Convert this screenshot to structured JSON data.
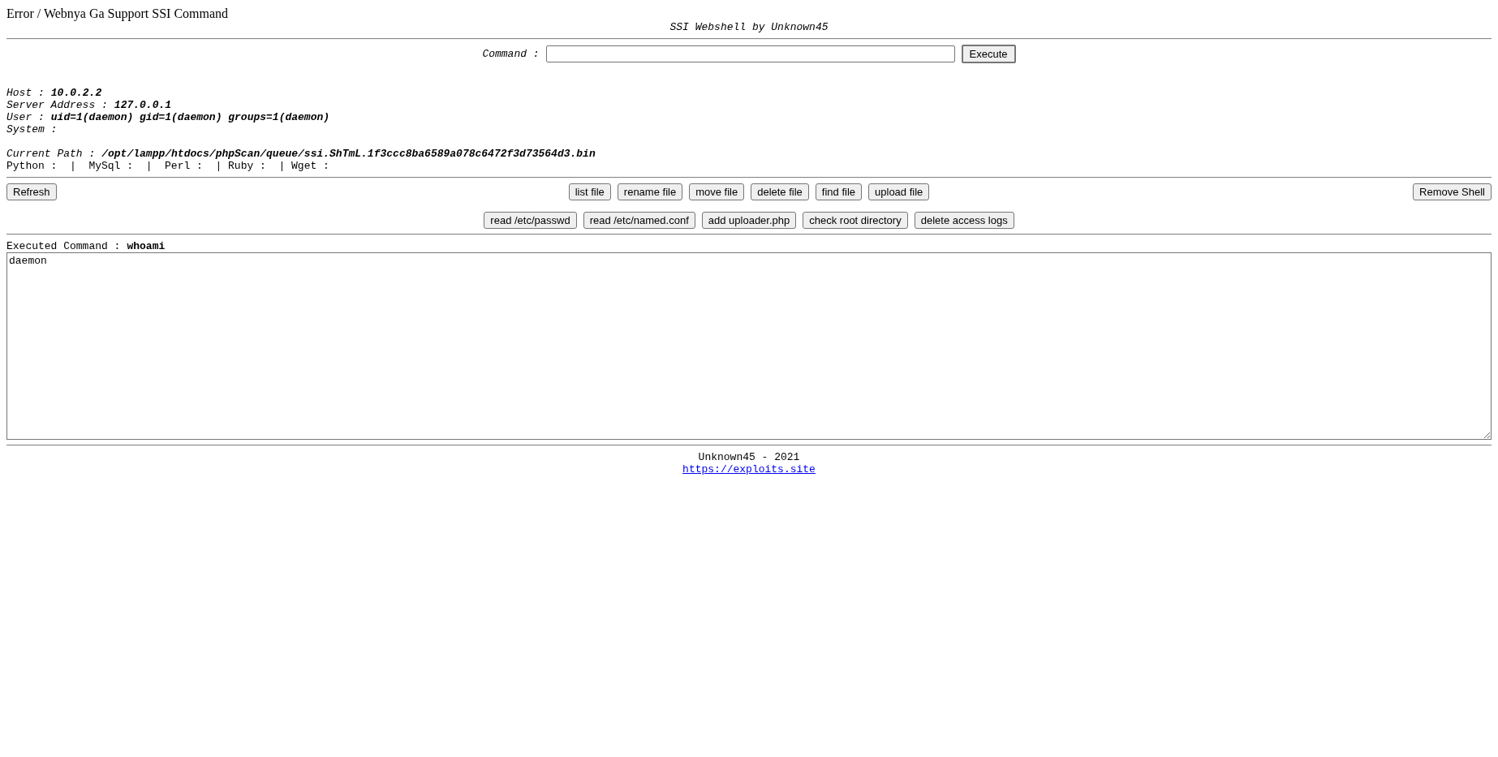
{
  "page_title": "Error / Webnya Ga Support SSI Command",
  "subtitle": "SSI Webshell by Unknown45",
  "command": {
    "label": "Command :",
    "button": "Execute"
  },
  "info": [
    {
      "label": "Host :",
      "value": "10.0.2.2"
    },
    {
      "label": "Server Address :",
      "value": "127.0.0.1"
    },
    {
      "label": "User :",
      "value": "uid=1(daemon) gid=1(daemon) groups=1(daemon)"
    },
    {
      "label": "System :"
    }
  ],
  "current_path": {
    "label": "Current Path :",
    "value": "/opt/lampp/htdocs/phpScan/queue/ssi.ShTmL.1f3ccc8ba6589a078c6472f3d73564d3.bin"
  },
  "tools_line": "Python :  |  MySql :  |  Perl :  | Ruby :  | Wget :",
  "left_button": "Refresh",
  "file_buttons": [
    "list file",
    "rename file",
    "move file",
    "delete file",
    "find file",
    "upload file"
  ],
  "right_button": "Remove Shell",
  "quick_buttons": [
    "read /etc/passwd",
    "read /etc/named.conf",
    "add uploader.php",
    "check root directory",
    "delete access logs"
  ],
  "executed": {
    "label": "Executed Command :",
    "value": "whoami"
  },
  "output": "daemon",
  "footer": {
    "credit": "Unknown45 - 2021",
    "link": "https://exploits.site"
  }
}
